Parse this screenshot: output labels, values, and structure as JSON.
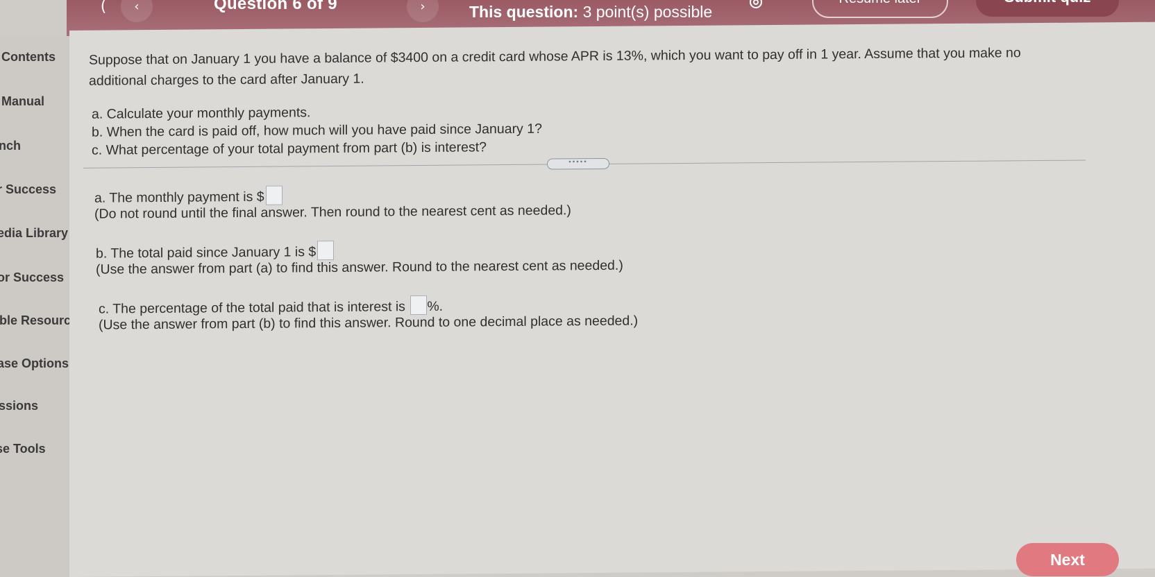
{
  "header": {
    "question_counter": "Question 6 of 9",
    "points_label": "This question:",
    "points_value": "3 point(s) possible",
    "resume_label": "Resume later",
    "submit_label": "Submit quiz",
    "back_first_icon": "chevron-left-icon",
    "back_icon": "chevron-left-icon",
    "next_icon": "chevron-right-icon",
    "settings_icon": "gear-icon"
  },
  "sidebar": {
    "items": [
      {
        "label": "Contents"
      },
      {
        "label": "Manual"
      },
      {
        "label": "nch"
      },
      {
        "label": "r Success"
      },
      {
        "label": "edia Library"
      },
      {
        "label": "or Success"
      },
      {
        "label": "ible Resourc"
      },
      {
        "label": "ase Options"
      },
      {
        "label": "ssions"
      },
      {
        "label": "se Tools"
      }
    ]
  },
  "question": {
    "intro_line1": "Suppose that on January 1 you have a balance of $3400 on a credit card whose APR is 13%, which you want to pay off in 1 year. Assume that you make no",
    "intro_line2": "additional charges to the card after January 1.",
    "part_a": "a. Calculate your monthly payments.",
    "part_b": "b. When the card is paid off, how much will you have paid since January 1?",
    "part_c": "c. What percentage of your total payment from part (b) is interest?"
  },
  "answers": {
    "a_label": "a. The monthly payment is $",
    "a_hint": "(Do not round until the final answer. Then round to the nearest cent as needed.)",
    "b_label": "b. The total paid since January 1 is $",
    "b_hint": "(Use the answer from part (a) to find this answer. Round to the nearest cent as needed.)",
    "c_label": "c. The percentage of the total paid that is interest is",
    "c_suffix": "%.",
    "c_hint": "(Use the answer from part (b) to find this answer. Round to one decimal place as needed.)",
    "a_value": "",
    "b_value": "",
    "c_value": ""
  },
  "footer": {
    "next_label": "Next"
  },
  "colors": {
    "header": "#a0626b",
    "next_button": "#e07a80"
  }
}
